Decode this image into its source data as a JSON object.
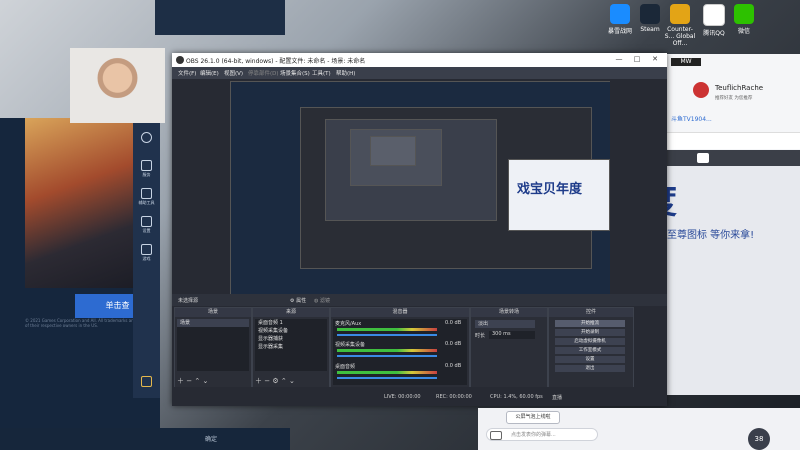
{
  "desktop": {
    "icons": [
      {
        "label": "暴雪战网",
        "color": "#1a8cff"
      },
      {
        "label": "Steam",
        "color": "#1b2838"
      },
      {
        "label": "Counter-S... Global Off...",
        "color": "#e3a416"
      },
      {
        "label": "腾讯QQ",
        "color": "#ffffff"
      },
      {
        "label": "微信",
        "color": "#2dc100"
      }
    ]
  },
  "launcher": {
    "play_button": "单击查",
    "legal": "© 2021 Games Corporation and All. All trademarks are property of their respective owners in the US.",
    "sidebar": [
      {
        "label": "首页"
      },
      {
        "label": "服务"
      },
      {
        "label": "辅助工具"
      },
      {
        "label": "设置"
      },
      {
        "label": "游戏"
      }
    ],
    "bottom_value": "确定"
  },
  "obs": {
    "title": "OBS 26.1.0 (64-bit, windows) - 配置文件: 未命名 - 场景: 未命名",
    "window_controls": {
      "minimize": "—",
      "maximize": "□",
      "close": "✕"
    },
    "menu": [
      "文件(F)",
      "编辑(E)",
      "视图(V)",
      "停靠部件(D)",
      "场景集合(S)",
      "工具(T)",
      "帮助(H)"
    ],
    "scene_bar": {
      "label": "未选择源",
      "properties": "属性",
      "filters": "滤镜"
    },
    "docks": {
      "scenes": {
        "title": "场景",
        "items": [
          "场景"
        ]
      },
      "sources": {
        "title": "来源",
        "items": [
          "桌面音频 1",
          "视频采集设备",
          "显示器捕获",
          "显示器采集"
        ]
      },
      "mixer": {
        "title": "混音器",
        "channels": [
          {
            "name": "麦克风/Aux",
            "db": "0.0 dB"
          },
          {
            "name": "视频采集设备",
            "db": "0.0 dB"
          },
          {
            "name": "桌面音频",
            "db": "0.0 dB"
          }
        ]
      },
      "transitions": {
        "title": "场景转场",
        "type": "淡出",
        "duration_label": "时长",
        "duration": "300 ms"
      },
      "controls": {
        "title": "控件",
        "buttons": [
          "开始推流",
          "开始录制",
          "启动虚拟摄像机",
          "工作室模式",
          "设置",
          "退出"
        ]
      }
    },
    "status": {
      "live": "LIVE: 00:00:00",
      "rec": "REC: 00:00:00",
      "cpu": "CPU: 1.4%, 60.00 fps",
      "label_prefix": "直播"
    }
  },
  "right_panel": {
    "user": "TeuflichRache",
    "desc": "推荐好友 为您推荐",
    "game_name": "斗鱼TV1904...",
    "banner_text": "戏宝贝年度",
    "banner_sub": "票、至尊图标 等你来拿!"
  },
  "chat": {
    "pill": "公屏气泡上线啦",
    "placeholder": "点击发表你的弹幕...",
    "counter": "38"
  },
  "chart_colors": {
    "accent": "#2d6bd1",
    "obs_bg": "#272a33"
  }
}
